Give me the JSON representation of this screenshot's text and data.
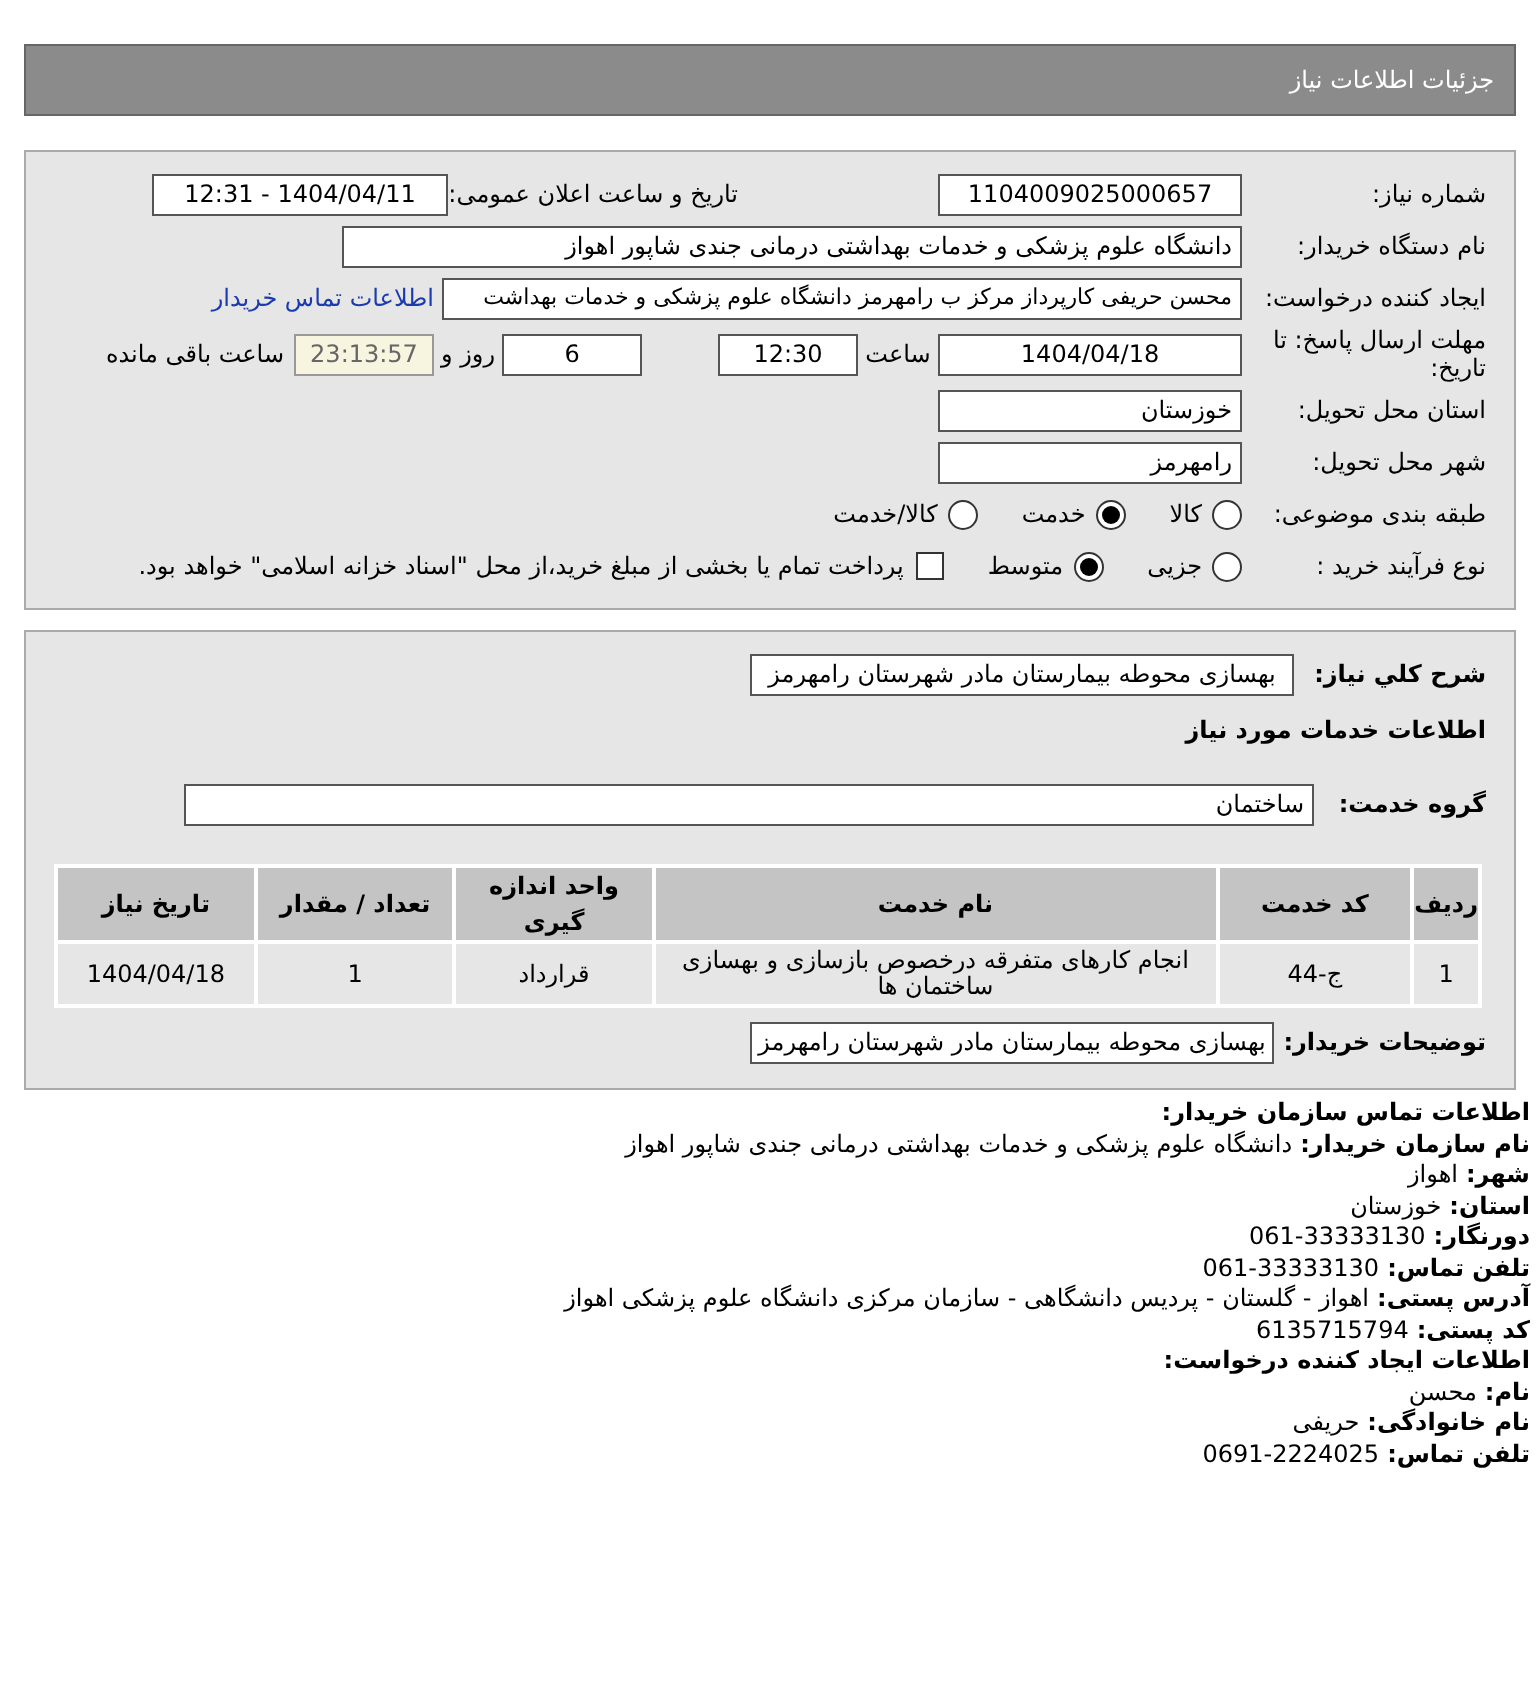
{
  "header": {
    "title": "جزئیات اطلاعات نیاز"
  },
  "details": {
    "need_number": {
      "label": "شماره نیاز:",
      "value": "1104009025000657"
    },
    "announce": {
      "label": "تاریخ و ساعت اعلان عمومی:",
      "value": "1404/04/11 - 12:31"
    },
    "buyer": {
      "label": "نام دستگاه خریدار:",
      "value": "دانشگاه علوم پزشکی و خدمات بهداشتی درمانی جندی شاپور اهواز"
    },
    "requester": {
      "label": "ایجاد کننده درخواست:",
      "value": "محسن حریفی کارپرداز مرکز ب رامهرمز دانشگاه علوم پزشکی و خدمات بهداشت",
      "link": "اطلاعات تماس خریدار"
    },
    "deadline": {
      "label": "مهلت ارسال پاسخ: تا تاریخ:",
      "date": "1404/04/18",
      "time_label": "ساعت",
      "time": "12:30",
      "days": "6",
      "days_label": "روز و",
      "remaining": "23:13:57",
      "remaining_label": "ساعت باقی مانده"
    },
    "province": {
      "label": "استان محل تحویل:",
      "value": "خوزستان"
    },
    "city": {
      "label": "شهر محل تحویل:",
      "value": "رامهرمز"
    },
    "category": {
      "label": "طبقه بندی موضوعی:",
      "options": [
        {
          "label": "کالا",
          "selected": false
        },
        {
          "label": "خدمت",
          "selected": true
        },
        {
          "label": "کالا/خدمت",
          "selected": false
        }
      ]
    },
    "process": {
      "label": "نوع فرآیند خرید :",
      "options": [
        {
          "label": "جزیی",
          "selected": false
        },
        {
          "label": "متوسط",
          "selected": true
        }
      ],
      "treasury": {
        "label": "پرداخت تمام یا بخشی از مبلغ خرید،از محل \"اسناد خزانه اسلامی\" خواهد بود.",
        "checked": false
      }
    }
  },
  "need": {
    "summary": {
      "label": "شرح کلي نياز:",
      "value": "بهسازی محوطه بیمارستان مادر شهرستان رامهرمز"
    },
    "services_title": "اطلاعات خدمات مورد نیاز",
    "group": {
      "label": "گروه خدمت:",
      "value": "ساختمان"
    },
    "table": {
      "columns": [
        "ردیف",
        "کد خدمت",
        "نام خدمت",
        "واحد اندازه گیری",
        "تعداد / مقدار",
        "تاریخ نیاز"
      ],
      "rows": [
        [
          "1",
          "ج-44",
          "انجام کارهای متفرقه درخصوص بازسازی و بهسازی ساختمان ها",
          "قرارداد",
          "1",
          "1404/04/18"
        ]
      ]
    },
    "buyer_notes": {
      "label": "توضیحات خریدار:",
      "value": "بهسازی محوطه بیمارستان مادر شهرستان رامهرمز"
    }
  },
  "contact": [
    {
      "kind": "heading",
      "label": "اطلاعات تماس سازمان خریدار:"
    },
    {
      "kind": "field",
      "label": "نام سازمان خریدار:",
      "value": "دانشگاه علوم پزشکی و خدمات بهداشتی درمانی جندی شاپور اهواز"
    },
    {
      "kind": "field",
      "label": "شهر:",
      "value": "اهواز"
    },
    {
      "kind": "field",
      "label": "استان:",
      "value": "خوزستان"
    },
    {
      "kind": "field",
      "label": "دورنگار:",
      "value": "061-33333130"
    },
    {
      "kind": "field",
      "label": "تلفن تماس:",
      "value": "061-33333130"
    },
    {
      "kind": "field",
      "label": "آدرس پستی:",
      "value": "اهواز - گلستان - پردیس دانشگاهی - سازمان مرکزی دانشگاه علوم پزشکی اهواز"
    },
    {
      "kind": "field",
      "label": "کد پستی:",
      "value": "6135715794"
    },
    {
      "kind": "heading",
      "label": "اطلاعات ایجاد کننده درخواست:"
    },
    {
      "kind": "field",
      "label": "نام:",
      "value": "محسن"
    },
    {
      "kind": "field",
      "label": "نام خانوادگی:",
      "value": "حریفی"
    },
    {
      "kind": "field",
      "label": "تلفن تماس:",
      "value": "0691-2224025"
    }
  ]
}
